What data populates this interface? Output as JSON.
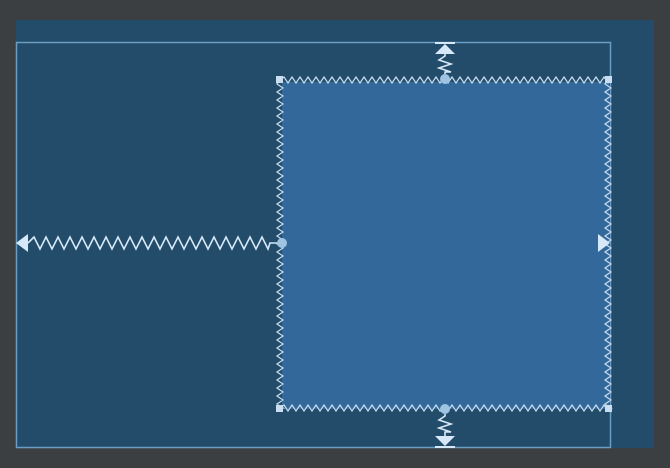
{
  "editor": {
    "background_color": "#3c3f41",
    "canvas_color": "#234c6a",
    "parent_border_color": "#6b9cc3",
    "child_fill_color": "#33689a",
    "constraint_color": "#d7e9f8"
  },
  "widget": {
    "type": "view",
    "horizontal_bias": 1.0,
    "vertical_bias": 0.5,
    "constraints": {
      "left": "parent-start",
      "top": "parent-top",
      "right": "parent-end",
      "bottom": "parent-bottom"
    }
  },
  "icons": {
    "top_anchor": "arrow-up-icon",
    "bottom_anchor": "arrow-down-icon",
    "left_anchor": "arrow-left-icon",
    "right_anchor": "arrow-right-icon"
  }
}
